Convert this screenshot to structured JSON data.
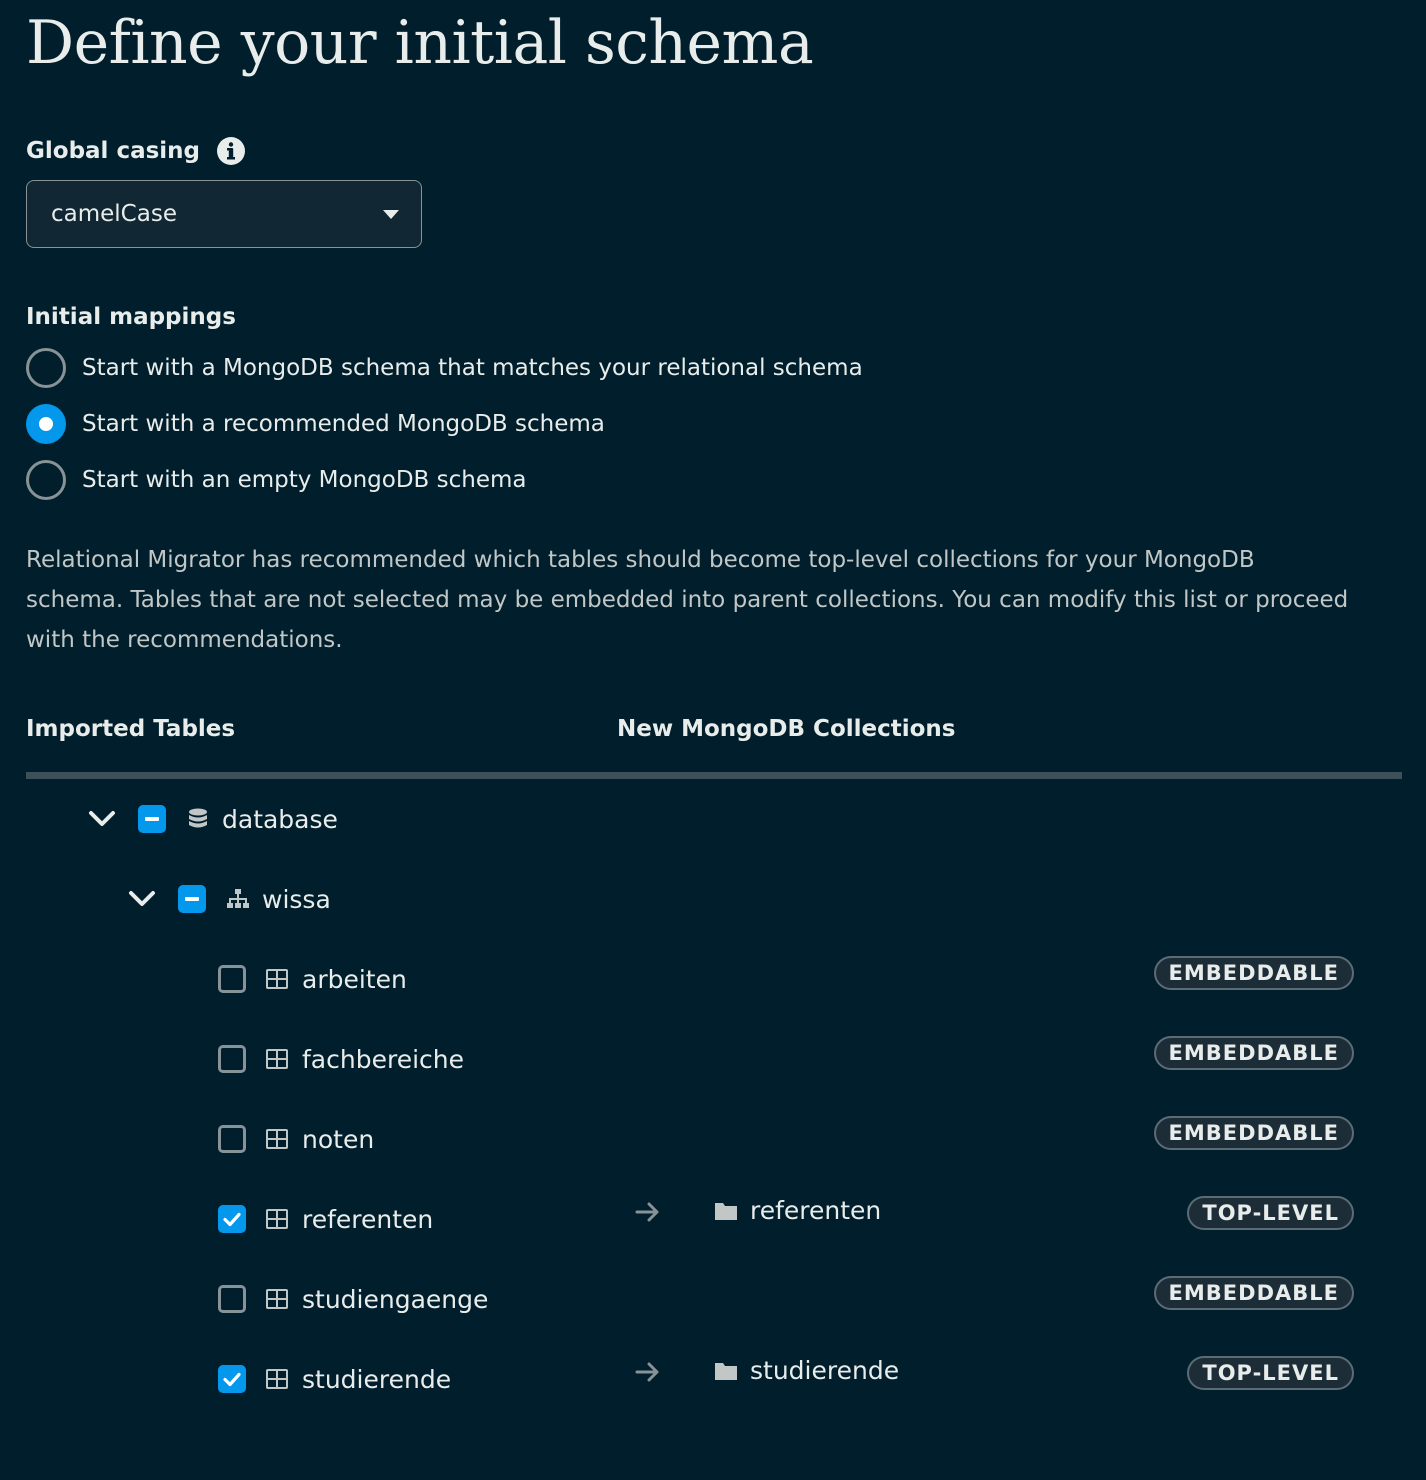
{
  "page": {
    "title": "Define your initial schema"
  },
  "casing": {
    "label": "Global casing",
    "selected": "camelCase"
  },
  "mappings": {
    "label": "Initial mappings",
    "options": [
      {
        "label": "Start with a MongoDB schema that matches your relational schema",
        "checked": false
      },
      {
        "label": "Start with a recommended MongoDB schema",
        "checked": true
      },
      {
        "label": "Start with an empty MongoDB schema",
        "checked": false
      }
    ]
  },
  "description": "Relational Migrator has recommended which tables should become top-level collections for your MongoDB schema. Tables that are not selected may be embedded into parent collections. You can modify this list or proceed with the recommendations.",
  "table_headers": {
    "imported": "Imported Tables",
    "collections": "New MongoDB Collections"
  },
  "tree": {
    "database": {
      "name": "database",
      "state": "indeterminate",
      "expanded": true
    },
    "schema": {
      "name": "wissa",
      "state": "indeterminate",
      "expanded": true
    },
    "tables": [
      {
        "name": "arbeiten",
        "checked": false,
        "badge": "EMBEDDABLE",
        "collection": ""
      },
      {
        "name": "fachbereiche",
        "checked": false,
        "badge": "EMBEDDABLE",
        "collection": ""
      },
      {
        "name": "noten",
        "checked": false,
        "badge": "EMBEDDABLE",
        "collection": ""
      },
      {
        "name": "referenten",
        "checked": true,
        "badge": "TOP-LEVEL",
        "collection": "referenten"
      },
      {
        "name": "studiengaenge",
        "checked": false,
        "badge": "EMBEDDABLE",
        "collection": ""
      },
      {
        "name": "studierende",
        "checked": true,
        "badge": "TOP-LEVEL",
        "collection": "studierende"
      }
    ]
  },
  "colors": {
    "background": "#001e2b",
    "accent": "#0498ec",
    "text": "#e8edeb",
    "muted": "#889397",
    "divider": "#3d4f58"
  }
}
